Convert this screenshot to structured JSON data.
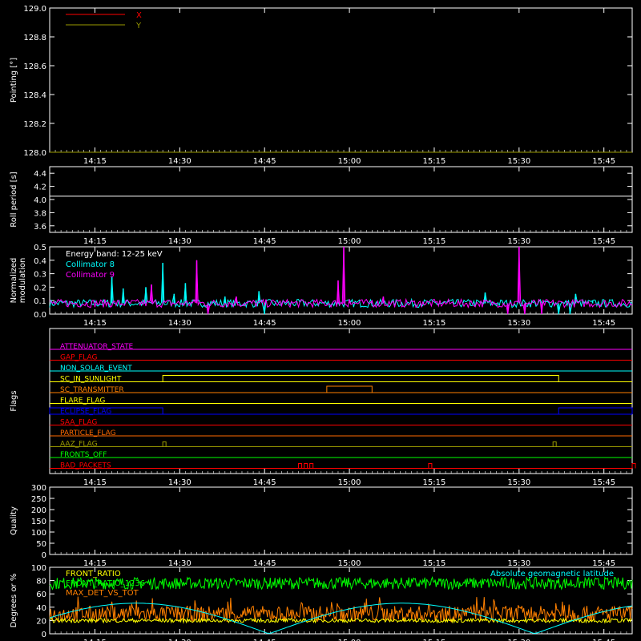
{
  "chart_data": [
    {
      "type": "line",
      "panel": "pointing",
      "ylabel": "Pointing [°]",
      "ylim": [
        128.0,
        129.0
      ],
      "yticks": [
        "128.0",
        "128.2",
        "128.4",
        "128.6",
        "128.8",
        "129.0"
      ],
      "xticks": [
        "14:15",
        "14:30",
        "14:45",
        "15:00",
        "15:15",
        "15:30",
        "15:45"
      ],
      "legend_placement": "top-left",
      "series": [
        {
          "name": "X",
          "color": "#ff0000",
          "x": [
            "14:07",
            "15:50"
          ],
          "values": [
            128.0,
            128.0
          ]
        },
        {
          "name": "Y",
          "color": "#9a9a00",
          "x": [
            "14:07",
            "15:50"
          ],
          "values": [
            128.0,
            128.0
          ]
        }
      ]
    },
    {
      "type": "line",
      "panel": "roll",
      "ylabel": "Roll period [s]",
      "ylim": [
        3.5,
        4.5
      ],
      "yticks": [
        "3.6",
        "3.8",
        "4.0",
        "4.2",
        "4.4"
      ],
      "xticks": [
        "14:15",
        "14:30",
        "14:45",
        "15:00",
        "15:15",
        "15:30",
        "15:45"
      ],
      "series": [
        {
          "color": "#ffffff",
          "x": [
            "14:07",
            "15:50"
          ],
          "values": [
            4.05,
            4.05
          ]
        }
      ]
    },
    {
      "type": "line",
      "panel": "modulation",
      "ylabel": "Normalized modulation",
      "ylim": [
        0.0,
        0.5
      ],
      "yticks": [
        "0.0",
        "0.1",
        "0.2",
        "0.3",
        "0.4",
        "0.5"
      ],
      "xticks": [
        "14:15",
        "14:30",
        "14:45",
        "15:00",
        "15:15",
        "15:30",
        "15:45"
      ],
      "annotation": "Energy band: 12-25 keV",
      "legend_placement": "top-left",
      "series": [
        {
          "name": "Collimator 8",
          "color": "#00ffff",
          "baseline": 0.08,
          "spikes": [
            [
              "14:18",
              0.28
            ],
            [
              "14:20",
              0.19
            ],
            [
              "14:24",
              0.2
            ],
            [
              "14:27",
              0.38
            ],
            [
              "14:29",
              0.15
            ],
            [
              "14:31",
              0.23
            ],
            [
              "14:38",
              0.13
            ],
            [
              "14:44",
              0.17
            ],
            [
              "14:45",
              0.0
            ],
            [
              "14:58",
              0.09
            ],
            [
              "15:24",
              0.16
            ],
            [
              "15:37",
              0.0
            ],
            [
              "15:38",
              0.08
            ],
            [
              "15:39",
              0.0
            ],
            [
              "15:40",
              0.15
            ],
            [
              "15:43",
              0.1
            ]
          ]
        },
        {
          "name": "Collimator 9",
          "color": "#ff00ff",
          "baseline": 0.08,
          "spikes": [
            [
              "14:25",
              0.22
            ],
            [
              "14:33",
              0.4
            ],
            [
              "14:35",
              0.0
            ],
            [
              "14:40",
              0.13
            ],
            [
              "14:58",
              0.25
            ],
            [
              "14:59",
              0.5
            ],
            [
              "15:00",
              0.11
            ],
            [
              "15:04",
              0.1
            ],
            [
              "15:06",
              0.13
            ],
            [
              "15:13",
              0.09
            ],
            [
              "15:26",
              0.08
            ],
            [
              "15:28",
              0.0
            ],
            [
              "15:30",
              0.5
            ],
            [
              "15:31",
              0.0
            ],
            [
              "15:34",
              0.0
            ]
          ]
        }
      ]
    },
    {
      "type": "line",
      "panel": "flags",
      "ylabel": "Flags",
      "xticks": [
        "14:15",
        "14:30",
        "14:45",
        "15:00",
        "15:15",
        "15:30",
        "15:45"
      ],
      "flags": [
        {
          "name": "ATTENUATOR_STATE",
          "color": "#ff00ff",
          "steps": []
        },
        {
          "name": "GAP_FLAG",
          "color": "#ff0000",
          "steps": []
        },
        {
          "name": "NON_SOLAR_EVENT",
          "color": "#00ffff",
          "steps": []
        },
        {
          "name": "SC_IN_SUNLIGHT",
          "color": "#ffff00",
          "steps": [
            [
              "14:27",
              "15:37"
            ]
          ]
        },
        {
          "name": "SC_TRANSMITTER",
          "color": "#ff8000",
          "steps": [
            [
              "14:56",
              "15:04"
            ]
          ]
        },
        {
          "name": "FLARE_FLAG",
          "color": "#ffff00",
          "steps": []
        },
        {
          "name": "ECLIPSE_FLAG",
          "color": "#0000ff",
          "steps": [
            [
              "14:07",
              "14:27"
            ],
            [
              "15:37",
              "15:50"
            ]
          ]
        },
        {
          "name": "SAA_FLAG",
          "color": "#ff0000",
          "steps": []
        },
        {
          "name": "PARTICLE_FLAG",
          "color": "#ff6a00",
          "steps": []
        },
        {
          "name": "AAZ_FLAG",
          "color": "#9a9a00",
          "pulses": [
            "14:27",
            "15:36"
          ]
        },
        {
          "name": "FRONTS_OFF",
          "color": "#00ff00",
          "steps": []
        },
        {
          "name": "BAD_PACKETS",
          "color": "#ff0000",
          "pulses": [
            "14:51",
            "14:52",
            "14:53",
            "15:14",
            "15:50"
          ]
        }
      ]
    },
    {
      "type": "line",
      "panel": "quality",
      "ylabel": "Quality",
      "ylim": [
        0,
        300
      ],
      "yticks": [
        "0",
        "50",
        "100",
        "150",
        "200",
        "250",
        "300"
      ],
      "xticks": [
        "14:15",
        "14:30",
        "14:45",
        "15:00",
        "15:15",
        "15:30",
        "15:45"
      ],
      "series": [
        {
          "color": "#ffffff",
          "x": [
            "14:07",
            "15:50"
          ],
          "values": [
            300,
            300
          ]
        }
      ]
    },
    {
      "type": "line",
      "panel": "ratios",
      "ylabel": "Degrees or %",
      "ylim": [
        0,
        100
      ],
      "yticks": [
        "0",
        "20",
        "40",
        "60",
        "80",
        "100"
      ],
      "xticks": [
        "14:15",
        "14:30",
        "14:45",
        "15:00",
        "15:15",
        "15:30",
        "15:45"
      ],
      "legend_placement": "top-left",
      "series": [
        {
          "name": "FRONT_RATIO",
          "color": "#ffff00",
          "baseline": 20,
          "noise": 3
        },
        {
          "name": "FRONT_RATIO_1236",
          "color": "#00ff00",
          "baseline": 76,
          "noise": 9
        },
        {
          "name": "MAX_DET_VS_TOT",
          "color": "#ff8000",
          "baseline": 30,
          "noise": 12
        },
        {
          "name": "Absolute geomagnetic latitude",
          "color": "#00ffff",
          "curve": "abs-sine"
        }
      ]
    }
  ]
}
